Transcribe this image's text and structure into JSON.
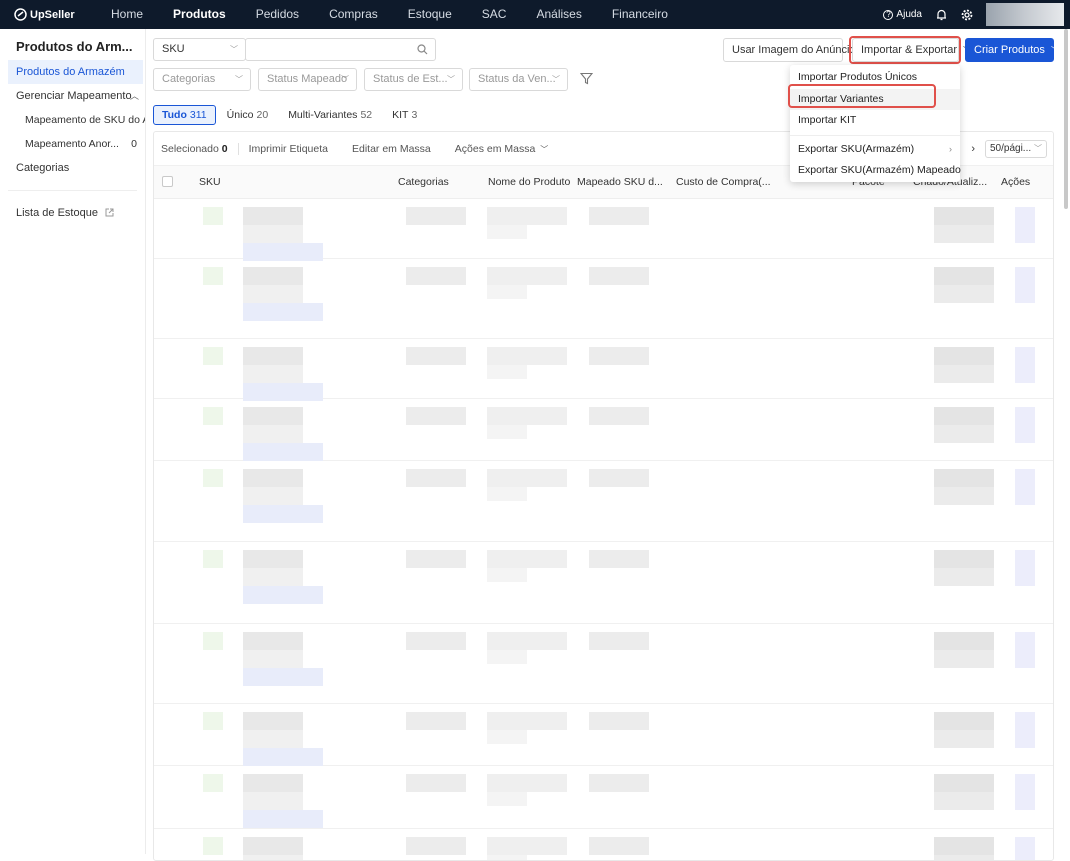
{
  "topbar": {
    "logo_text": "UpSeller",
    "nav": [
      "Home",
      "Produtos",
      "Pedidos",
      "Compras",
      "Estoque",
      "SAC",
      "Análises",
      "Financeiro"
    ],
    "active_nav": "Produtos",
    "help_label": "Ajuda",
    "colors": {
      "bg": "#0e1a2b",
      "accent": "#1a56d6",
      "highlight": "#e0504a"
    }
  },
  "sidebar": {
    "title": "Produtos do Arm...",
    "items": [
      {
        "label": "Produtos do Armazém",
        "active": true
      },
      {
        "label": "Gerenciar Mapeamento",
        "caret": "^"
      },
      {
        "label": "Mapeamento de SKU do A...",
        "sub": true
      },
      {
        "label": "Mapeamento Anor...",
        "sub": true,
        "count": "0"
      },
      {
        "label": "Categorias"
      },
      {
        "label": "Lista de Estoque",
        "external_icon": true
      }
    ]
  },
  "filters": {
    "search_type": "SKU",
    "search_placeholder": "",
    "categorias": "Categorias",
    "status_mapeado": "Status Mapeado",
    "status_estoque": "Status de Est...",
    "status_venda": "Status da Ven..."
  },
  "actions": {
    "usar_imagem": "Usar Imagem do Anúncio",
    "importar_exportar": "Importar & Exportar",
    "criar_produtos": "Criar Produtos"
  },
  "dropdown": {
    "items": [
      "Importar Produtos Únicos",
      "Importar Variantes",
      "Importar KIT",
      "Exportar SKU(Armazém)",
      "Exportar SKU(Armazém) Mapeado"
    ],
    "highlighted": "Importar Variantes"
  },
  "tabs": [
    {
      "label": "Tudo",
      "count": "311",
      "active": true
    },
    {
      "label": "Único",
      "count": "20"
    },
    {
      "label": "Multi-Variantes",
      "count": "52"
    },
    {
      "label": "KIT",
      "count": "3"
    }
  ],
  "bulkbar": {
    "selecionado_label": "Selecionado",
    "selecionado_count": "0",
    "imprimir": "Imprimir Etiqueta",
    "editar": "Editar em Massa",
    "acoes": "Ações em Massa",
    "page_size": "50/pági..."
  },
  "table": {
    "columns": [
      "SKU",
      "Categorias",
      "Nome do Produto",
      "Mapeado SKU d...",
      "Custo de Compra(...",
      "Pacote",
      "Criado/Atualiz...",
      "Ações"
    ]
  }
}
